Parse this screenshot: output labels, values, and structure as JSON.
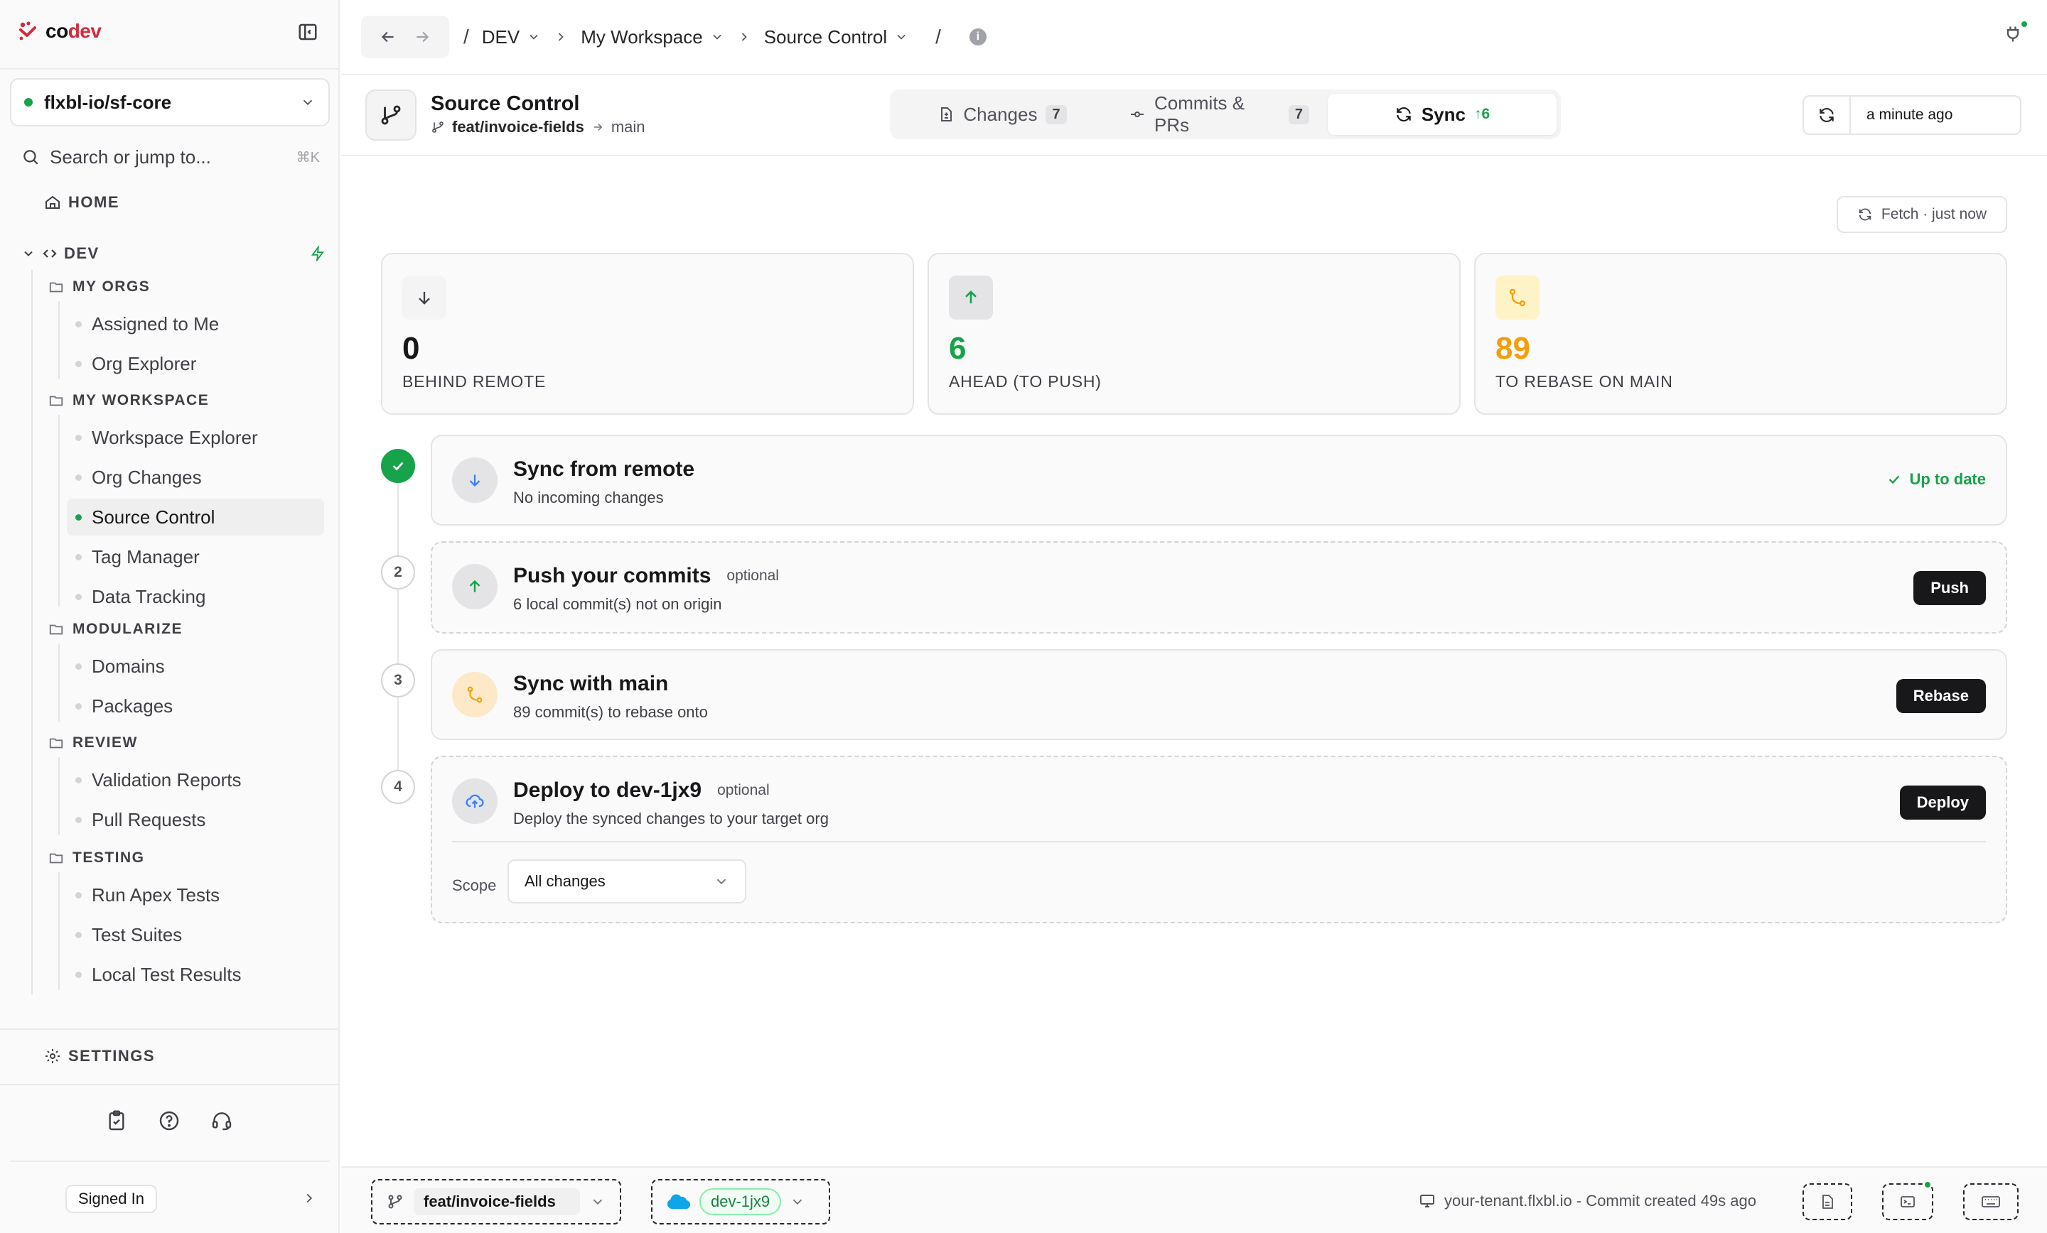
{
  "app": {
    "logo_prefix": "co",
    "logo_suffix": "dev",
    "logo_icon": "codev-logo",
    "brand_color": "#d42a3c",
    "accent_color": "#16a34a",
    "warning_color": "#f59e0b",
    "info_color": "#3b82f6"
  },
  "sidebar": {
    "repo": "flxbl-io/sf-core",
    "search_placeholder": "Search or jump to...",
    "search_shortcut": "⌘K",
    "home_label": "HOME",
    "section_label": "DEV",
    "groups": [
      {
        "label": "MY ORGS",
        "items": [
          "Assigned to Me",
          "Org Explorer"
        ]
      },
      {
        "label": "MY WORKSPACE",
        "items": [
          "Workspace Explorer",
          "Org Changes",
          "Source Control",
          "Tag Manager",
          "Data Tracking"
        ]
      },
      {
        "label": "MODULARIZE",
        "items": [
          "Domains",
          "Packages"
        ]
      },
      {
        "label": "REVIEW",
        "items": [
          "Validation Reports",
          "Pull Requests"
        ]
      },
      {
        "label": "TESTING",
        "items": [
          "Run Apex Tests",
          "Test Suites",
          "Local Test Results"
        ]
      }
    ],
    "active_item": "Source Control",
    "settings_label": "SETTINGS",
    "utility_icons": [
      "clipboard-icon",
      "help-icon",
      "headset-icon"
    ],
    "signed_in_label": "Signed In"
  },
  "topbar": {
    "breadcrumb": [
      "DEV",
      "My Workspace",
      "Source Control"
    ]
  },
  "page": {
    "title": "Source Control",
    "branch": "feat/invoice-fields",
    "target_branch": "main",
    "tabs": [
      {
        "label": "Changes",
        "count": "7",
        "icon": "file-diff-icon"
      },
      {
        "label": "Commits & PRs",
        "count": "7",
        "icon": "commit-icon"
      },
      {
        "label": "Sync",
        "count": "↑6",
        "icon": "sync-icon"
      }
    ],
    "active_tab": "Sync",
    "last_refreshed": "a minute ago"
  },
  "main": {
    "fetch_label": "Fetch · just now",
    "stats": [
      {
        "value": "0",
        "label": "BEHIND REMOTE",
        "color": "#18181b"
      },
      {
        "value": "6",
        "label": "AHEAD (TO PUSH)",
        "color": "#16a34a"
      },
      {
        "value": "89",
        "label": "TO REBASE ON MAIN",
        "color": "#f59e0b"
      }
    ],
    "steps": [
      {
        "number": "1",
        "title": "Sync from remote",
        "subtitle": "No incoming changes",
        "status": "Up to date"
      },
      {
        "number": "2",
        "title": "Push your commits",
        "optional": "optional",
        "subtitle": "6 local commit(s) not on origin",
        "action": "Push"
      },
      {
        "number": "3",
        "title": "Sync with main",
        "subtitle": "89 commit(s) to rebase onto",
        "action": "Rebase"
      },
      {
        "number": "4",
        "title": "Deploy to dev-1jx9",
        "optional": "optional",
        "subtitle": "Deploy the synced changes to your target org",
        "action": "Deploy",
        "scope_label": "Scope",
        "scope_value": "All changes"
      }
    ]
  },
  "footer": {
    "branch": "feat/invoice-fields",
    "org": "dev-1jx9",
    "status": "your-tenant.flxbl.io - Commit created 49s ago"
  }
}
